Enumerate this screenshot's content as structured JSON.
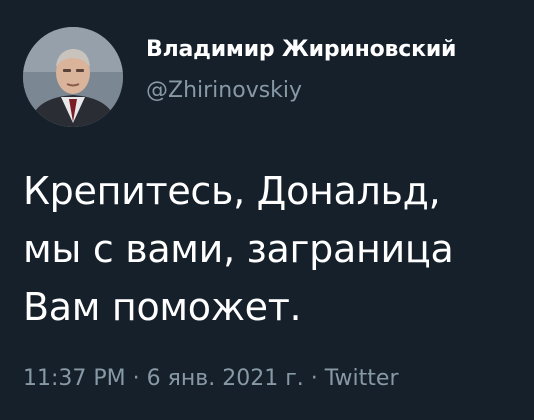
{
  "author": {
    "display_name": "Владимир Жириновский",
    "handle": "@Zhirinovskiy",
    "avatar_icon": "profile-photo"
  },
  "tweet": {
    "lines": [
      "Крепитесь, Дональд,",
      "мы с вами, заграница",
      "Вам поможет."
    ]
  },
  "meta": {
    "time": "11:37 PM",
    "date": "6 янв. 2021 г.",
    "source": "Twitter",
    "separator": "·"
  },
  "colors": {
    "background": "#15202b",
    "text": "#ffffff",
    "secondary_text": "#8899a6"
  }
}
